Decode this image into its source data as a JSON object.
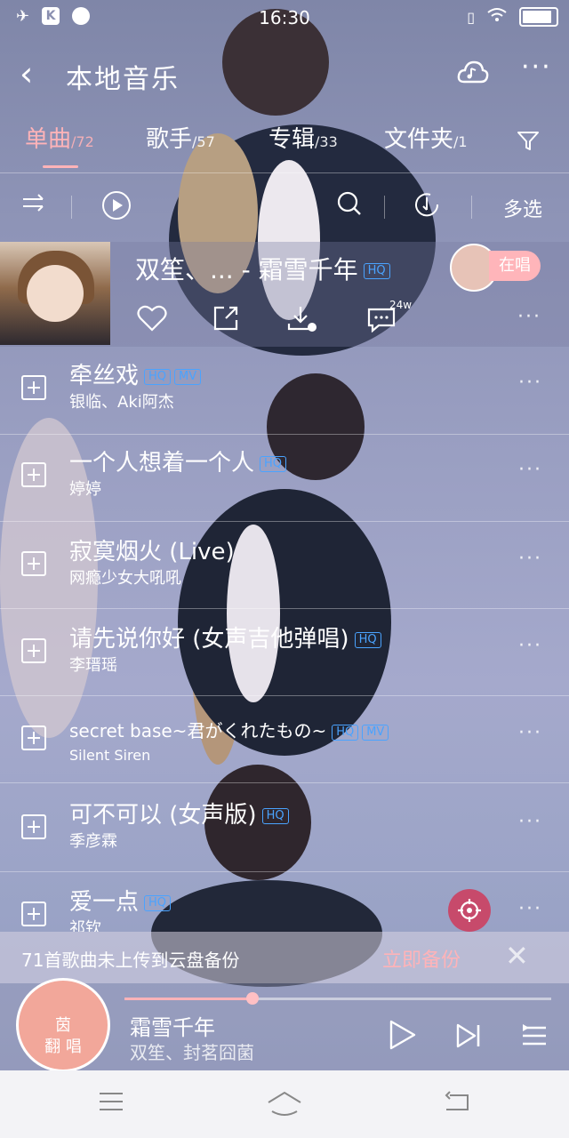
{
  "status_bar": {
    "time": "16:30",
    "app_badge": "K"
  },
  "header": {
    "title": "本地音乐",
    "more": "···"
  },
  "tabs": [
    {
      "label": "单曲",
      "count": "/72"
    },
    {
      "label": "歌手",
      "count": "/57"
    },
    {
      "label": "专辑",
      "count": "/33"
    },
    {
      "label": "文件夹",
      "count": "/1"
    }
  ],
  "toolbar": {
    "multi_select": "多选"
  },
  "now_playing": {
    "title": "双笙、... - 霜雪千年",
    "quality": "HQ",
    "badge": "在唱",
    "comment_count": "24w",
    "more": "···"
  },
  "songs": [
    {
      "title": "牵丝戏",
      "artist": "银临、Aki阿杰",
      "tags": [
        "HQ",
        "MV"
      ]
    },
    {
      "title": "一个人想着一个人",
      "artist": "婷婷",
      "tags": [
        "HQ"
      ]
    },
    {
      "title": "寂寞烟火 (Live)",
      "artist": "网瘾少女大吼吼",
      "tags": []
    },
    {
      "title": "请先说你好 (女声吉他弹唱)",
      "artist": "李瑨瑶",
      "tags": [
        "HQ"
      ]
    },
    {
      "title": "secret base~君がくれたもの~",
      "artist": "Silent Siren",
      "tags": [
        "HQ",
        "MV"
      ]
    },
    {
      "title": "可不可以 (女声版)",
      "artist": "季彦霖",
      "tags": [
        "HQ"
      ]
    },
    {
      "title": "爱一点",
      "artist": "祁钦",
      "tags": [
        "HQ"
      ]
    }
  ],
  "backup_banner": {
    "message": "71首歌曲未上传到云盘备份",
    "action": "立即备份",
    "close": "✕"
  },
  "player": {
    "cover_text_1": "茵",
    "cover_text_2": "翻 唱",
    "title": "霜雪千年",
    "artist": "双笙、封茗囧菌",
    "progress": 0.3
  },
  "colors": {
    "accent": "#ffb3b8",
    "quality_tag": "#4aa3ff",
    "locate_button": "#c74a6b"
  }
}
